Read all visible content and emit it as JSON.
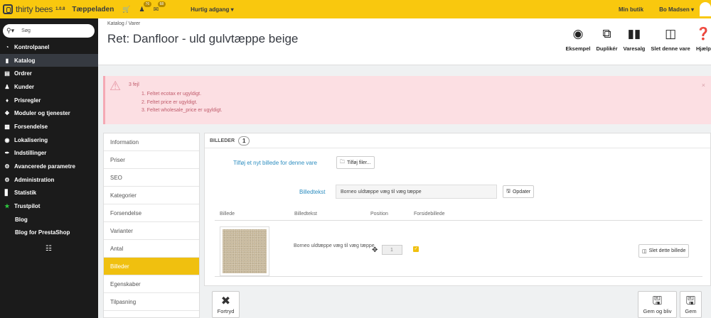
{
  "topbar": {
    "brand": "thirty bees",
    "version": "1.0.8",
    "shop": "Tæppeladen",
    "cart_icon": "cart-icon",
    "customers_badge": "76",
    "messages_badge": "68",
    "quick_access": "Hurtig adgang ▾",
    "my_shop": "Min butik",
    "user": "Bo Madsen ▾"
  },
  "sidebar": {
    "search_placeholder": "Søg",
    "items": [
      {
        "label": "Kontrolpanel",
        "icon": "dashboard-icon"
      },
      {
        "label": "Katalog",
        "icon": "book-icon"
      },
      {
        "label": "Ordrer",
        "icon": "credit-card-icon"
      },
      {
        "label": "Kunder",
        "icon": "users-icon"
      },
      {
        "label": "Prisregler",
        "icon": "tags-icon"
      },
      {
        "label": "Moduler og tjenester",
        "icon": "puzzle-icon"
      },
      {
        "label": "Forsendelse",
        "icon": "truck-icon"
      },
      {
        "label": "Lokalisering",
        "icon": "globe-icon"
      },
      {
        "label": "Indstillinger",
        "icon": "wrench-icon"
      },
      {
        "label": "Avancerede parametre",
        "icon": "cogs-icon"
      },
      {
        "label": "Administration",
        "icon": "cog-icon"
      },
      {
        "label": "Statistik",
        "icon": "bar-chart-icon"
      },
      {
        "label": "Trustpilot",
        "icon": "star-icon"
      },
      {
        "label": "Blog",
        "icon": ""
      },
      {
        "label": "Blog for PrestaShop",
        "icon": ""
      }
    ],
    "collapse_icon": "collapse-icon"
  },
  "header": {
    "breadcrumb": "Katalog  /  Varer",
    "title": "Ret: Danfloor - uld gulvtæppe beige",
    "toolbar": [
      {
        "label": "Eksempel",
        "icon": "eye-icon"
      },
      {
        "label": "Duplikér",
        "icon": "copy-icon"
      },
      {
        "label": "Varesalg",
        "icon": "bar-chart-icon"
      },
      {
        "label": "Slet denne vare",
        "icon": "trash-icon"
      },
      {
        "label": "Hjælp",
        "icon": "question-icon"
      }
    ]
  },
  "alert": {
    "count": "3 fejl",
    "errors": [
      "1. Feltet ecotax er ugyldigt.",
      "2. Feltet price er ugyldigt.",
      "3. Feltet wholesale_price er ugyldigt."
    ],
    "close": "×"
  },
  "tabs": [
    "Information",
    "Priser",
    "SEO",
    "Kategorier",
    "Forsendelse",
    "Varianter",
    "Antal",
    "Billeder",
    "Egenskaber",
    "Tilpasning"
  ],
  "active_tab": "Billeder",
  "panel": {
    "title": "BILLEDER",
    "count": "1",
    "add_label": "Tilføj et nyt billede for denne vare",
    "add_button": "Tilføj filer...",
    "caption_label": "Billedtekst",
    "caption_value": "Borneo uldtæppe væg til væg tæppe",
    "update_button": "Opdater",
    "columns": [
      "Billede",
      "Billedtekst",
      "Position",
      "Forsidebillede"
    ],
    "rows": [
      {
        "caption": "Borneo uldtæppe væg til væg tæppe",
        "position": "1",
        "cover": true,
        "delete": "Slet dette billede"
      }
    ]
  },
  "footer": {
    "cancel": "Fortryd",
    "save_stay": "Gem og bliv",
    "save": "Gem"
  }
}
